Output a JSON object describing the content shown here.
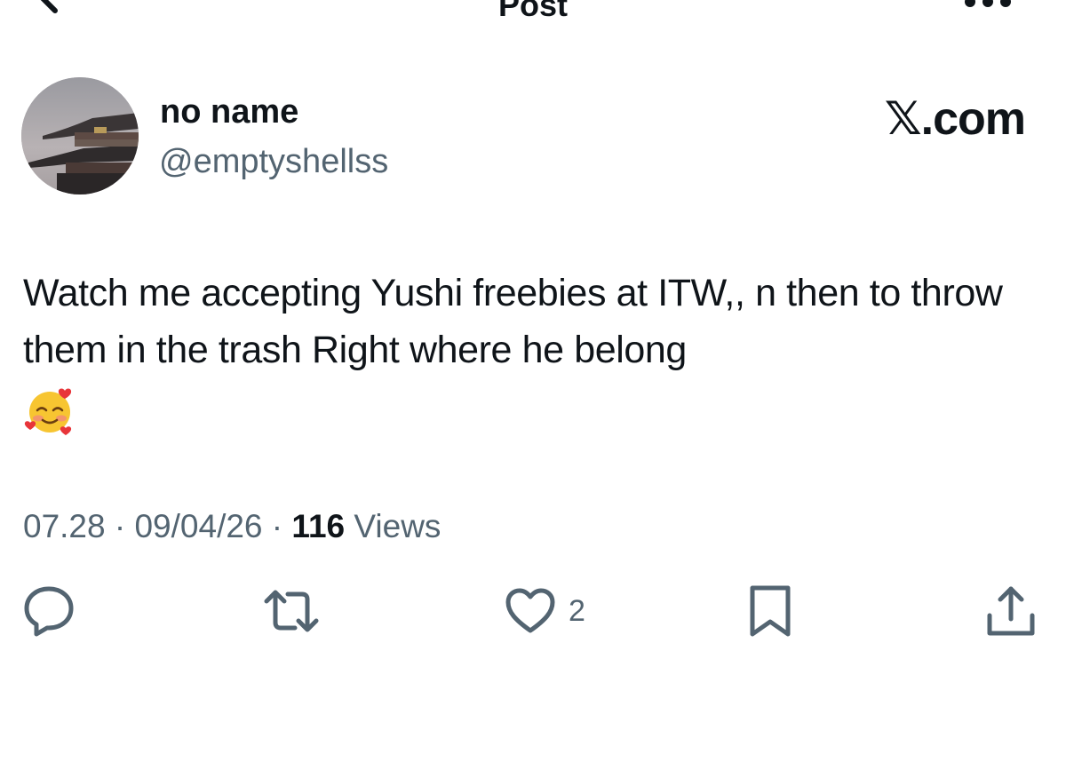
{
  "header": {
    "title": "Post",
    "back_icon": "arrow-left-icon",
    "more_icon": "more-horizontal-icon"
  },
  "author": {
    "display_name": "no name",
    "handle": "@emptyshellss",
    "avatar": "palace-roof-photo"
  },
  "watermark": "𝕏.com",
  "post": {
    "text": "Watch me accepting Yushi freebies at ITW,, n then to throw them in the trash Right where he belong",
    "emoji": "smiling-face-with-hearts-emoji"
  },
  "meta": {
    "time": "07.28",
    "separator": " · ",
    "date": "09/04/26",
    "views_count": "116",
    "views_label": " Views"
  },
  "actions": {
    "reply_icon": "reply-icon",
    "repost_icon": "repost-icon",
    "like_icon": "heart-icon",
    "like_count": "2",
    "bookmark_icon": "bookmark-icon",
    "share_icon": "share-icon"
  },
  "colors": {
    "text_primary": "#0f1419",
    "text_secondary": "#536471",
    "background": "#ffffff"
  }
}
